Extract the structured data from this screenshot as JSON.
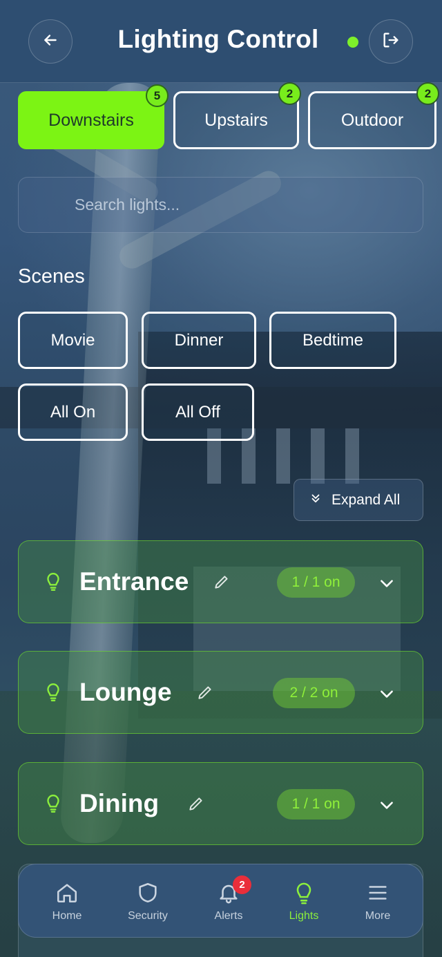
{
  "header": {
    "title": "Lighting Control",
    "back_icon": "arrow-left-icon",
    "logout_icon": "logout-icon",
    "status_color": "#7ef02a"
  },
  "floors": [
    {
      "label": "Downstairs",
      "count": "5",
      "active": true
    },
    {
      "label": "Upstairs",
      "count": "2",
      "active": false
    },
    {
      "label": "Outdoor",
      "count": "2",
      "active": false
    }
  ],
  "search": {
    "placeholder": "Search lights...",
    "value": ""
  },
  "scenes": {
    "title": "Scenes",
    "items": [
      "Movie",
      "Dinner",
      "Bedtime",
      "All On",
      "All Off"
    ]
  },
  "expand_all": {
    "label": "Expand All",
    "icon": "double-chevron-down-icon"
  },
  "rooms": [
    {
      "name": "Entrance",
      "status": "1 / 1 on"
    },
    {
      "name": "Lounge",
      "status": "2 / 2 on"
    },
    {
      "name": "Dining",
      "status": "1 / 1 on"
    }
  ],
  "nav": {
    "items": [
      {
        "label": "Home",
        "icon": "home-icon"
      },
      {
        "label": "Security",
        "icon": "shield-icon"
      },
      {
        "label": "Alerts",
        "icon": "bell-icon",
        "badge": "2"
      },
      {
        "label": "Lights",
        "icon": "lightbulb-icon",
        "active": true
      },
      {
        "label": "More",
        "icon": "menu-icon"
      }
    ]
  },
  "colors": {
    "accent": "#7cf414",
    "header_bg": "#2c4c70",
    "room_bg": "#468c46",
    "alert_badge": "#ea2e3a"
  }
}
